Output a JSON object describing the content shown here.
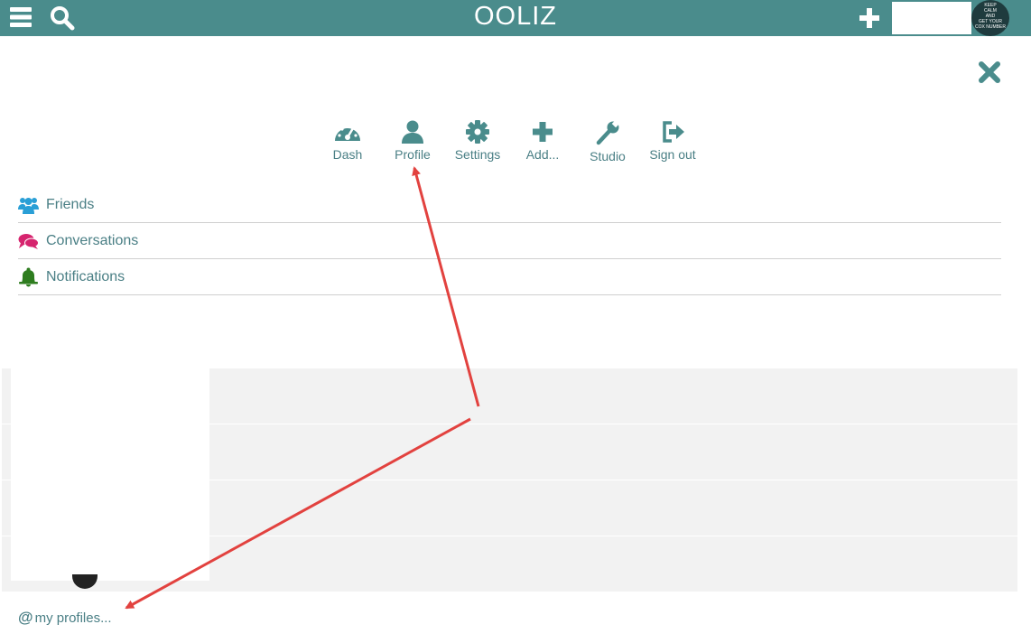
{
  "header": {
    "brand": "OOLIZ",
    "avatar_lines": [
      "KEEP",
      "CALM",
      "AND",
      "GET YOUR",
      "COX NUMBER"
    ],
    "bar_color": "#4a8c8c"
  },
  "quick_nav": [
    {
      "label": "Dash",
      "icon": "dashboard-icon"
    },
    {
      "label": "Profile",
      "icon": "user-icon"
    },
    {
      "label": "Settings",
      "icon": "gear-icon"
    },
    {
      "label": "Add...",
      "icon": "plus-icon"
    },
    {
      "label": "Studio",
      "icon": "wrench-icon"
    },
    {
      "label": "Sign out",
      "icon": "sign-out-icon"
    }
  ],
  "menu": [
    {
      "label": "Friends",
      "icon": "users-icon",
      "icon_color": "#2a9fd6"
    },
    {
      "label": "Conversations",
      "icon": "comments-icon",
      "icon_color": "#d6246e"
    },
    {
      "label": "Notifications",
      "icon": "bell-icon",
      "icon_color": "#2e7d1f"
    }
  ],
  "footer": {
    "at_symbol": "@",
    "my_profiles": "my profiles..."
  },
  "colors": {
    "accent": "#4a8c8c",
    "text": "#4a7f85",
    "annotation_arrow": "#e2423f"
  }
}
